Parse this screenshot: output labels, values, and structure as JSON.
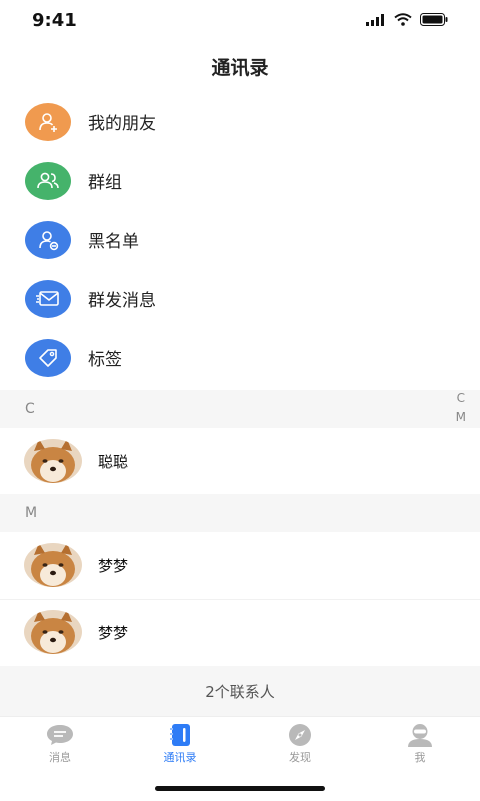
{
  "status_bar": {
    "time": "9:41"
  },
  "header": {
    "title": "通讯录"
  },
  "functions": [
    {
      "label": "我的朋友",
      "icon": "add-friend-icon",
      "color": "#f09a4f"
    },
    {
      "label": "群组",
      "icon": "group-icon",
      "color": "#45b36b"
    },
    {
      "label": "黑名单",
      "icon": "blocked-user-icon",
      "color": "#3f7ee6"
    },
    {
      "label": "群发消息",
      "icon": "mail-icon",
      "color": "#3f7ee6"
    },
    {
      "label": "标签",
      "icon": "tag-icon",
      "color": "#3f7ee6"
    }
  ],
  "sections": [
    {
      "letter": "C",
      "contacts": [
        {
          "name": "聪聪"
        }
      ]
    },
    {
      "letter": "M",
      "contacts": [
        {
          "name": "梦梦"
        },
        {
          "name": "梦梦"
        }
      ]
    }
  ],
  "index_bar": [
    "C",
    "M"
  ],
  "contacts_count": "2个联系人",
  "tabs": [
    {
      "label": "消息",
      "icon": "chat-bubble-icon",
      "active": false
    },
    {
      "label": "通讯录",
      "icon": "contacts-book-icon",
      "active": true
    },
    {
      "label": "发现",
      "icon": "compass-icon",
      "active": false
    },
    {
      "label": "我",
      "icon": "profile-icon",
      "active": false
    }
  ],
  "colors": {
    "accent": "#2e7cf6",
    "section_bg": "#f6f6f6"
  }
}
